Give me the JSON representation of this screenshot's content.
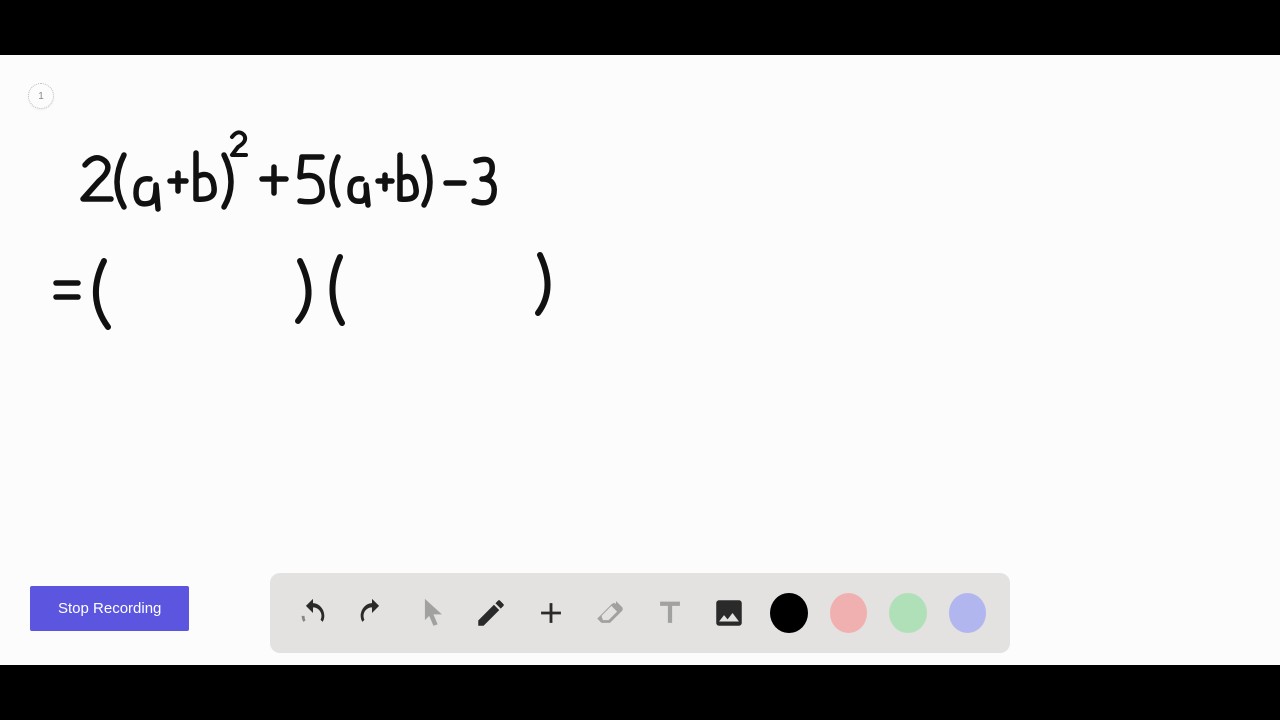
{
  "page_indicator": "1",
  "handwriting": {
    "line1": "2(a+b)² + 5(a+b) − 3",
    "line2": "= (        )(        )"
  },
  "controls": {
    "stop_recording_label": "Stop Recording"
  },
  "toolbar": {
    "undo": "undo",
    "redo": "redo",
    "pointer": "pointer",
    "pencil": "pencil",
    "add": "add",
    "eraser": "eraser",
    "text": "text",
    "image": "image"
  },
  "colors": {
    "black": "#000000",
    "pink": "#f1b0b0",
    "green": "#b0e0b8",
    "blue": "#b2b6ef"
  }
}
